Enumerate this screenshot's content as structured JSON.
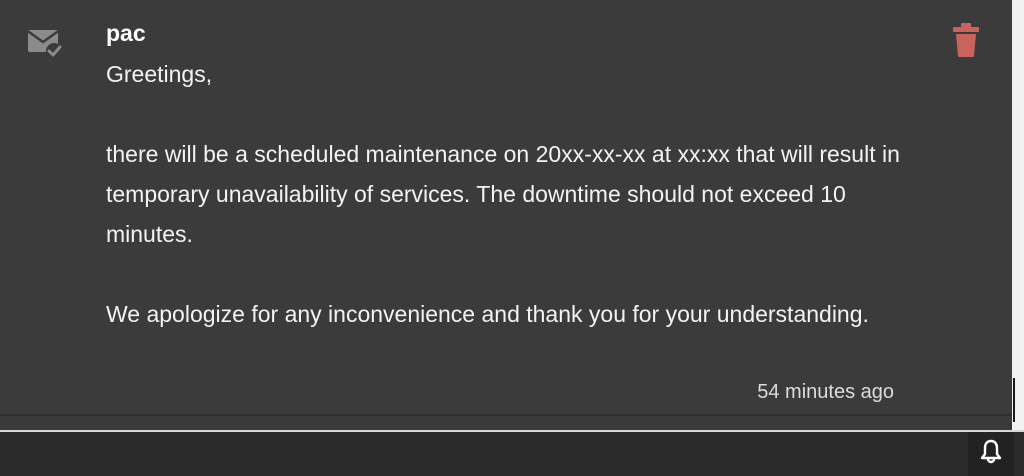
{
  "notification": {
    "sender": "pac",
    "message": "Greetings,\n\nthere will be a scheduled maintenance on 20xx-xx-xx at xx:xx that will result in temporary unavailability of services. The downtime should not exceed 10 minutes.\n\nWe apologize for any inconvenience and thank you for your understanding.",
    "timestamp": "54 minutes ago",
    "read_icon": "mail-read-icon",
    "delete_icon": "trash-icon"
  },
  "footer": {
    "bell_icon": "bell-icon"
  },
  "colors": {
    "panel_bg": "#3b3b3b",
    "footer_bg": "#2b2b2b",
    "text": "#f3f3f3",
    "delete_accent": "#c9645d",
    "icon_muted": "#8b8b8b"
  }
}
